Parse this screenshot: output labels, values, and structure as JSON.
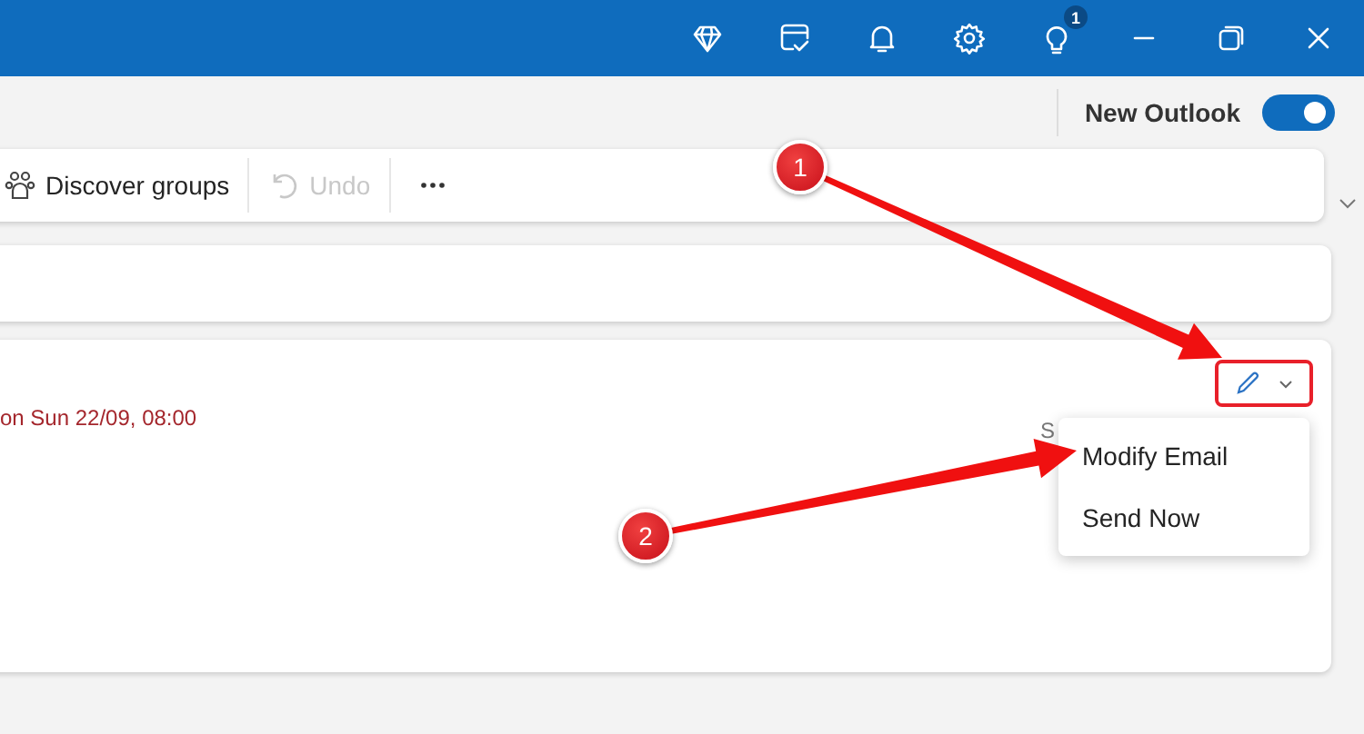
{
  "title_bar": {
    "notification_count": "1"
  },
  "mode_switch": {
    "label": "New Outlook",
    "on": true
  },
  "toolbar": {
    "items": [
      {
        "kind": "groups",
        "label": "Discover groups",
        "disabled": false
      },
      {
        "kind": "undo",
        "label": "Undo",
        "disabled": true
      },
      {
        "kind": "more"
      }
    ]
  },
  "message": {
    "schedule_text": "on Sun 22/09, 08:00",
    "partial_text": "S"
  },
  "edit_menu": {
    "items": [
      {
        "label": "Modify Email"
      },
      {
        "label": "Send Now"
      }
    ]
  },
  "annotations": [
    {
      "number": "1"
    },
    {
      "number": "2"
    }
  ]
}
